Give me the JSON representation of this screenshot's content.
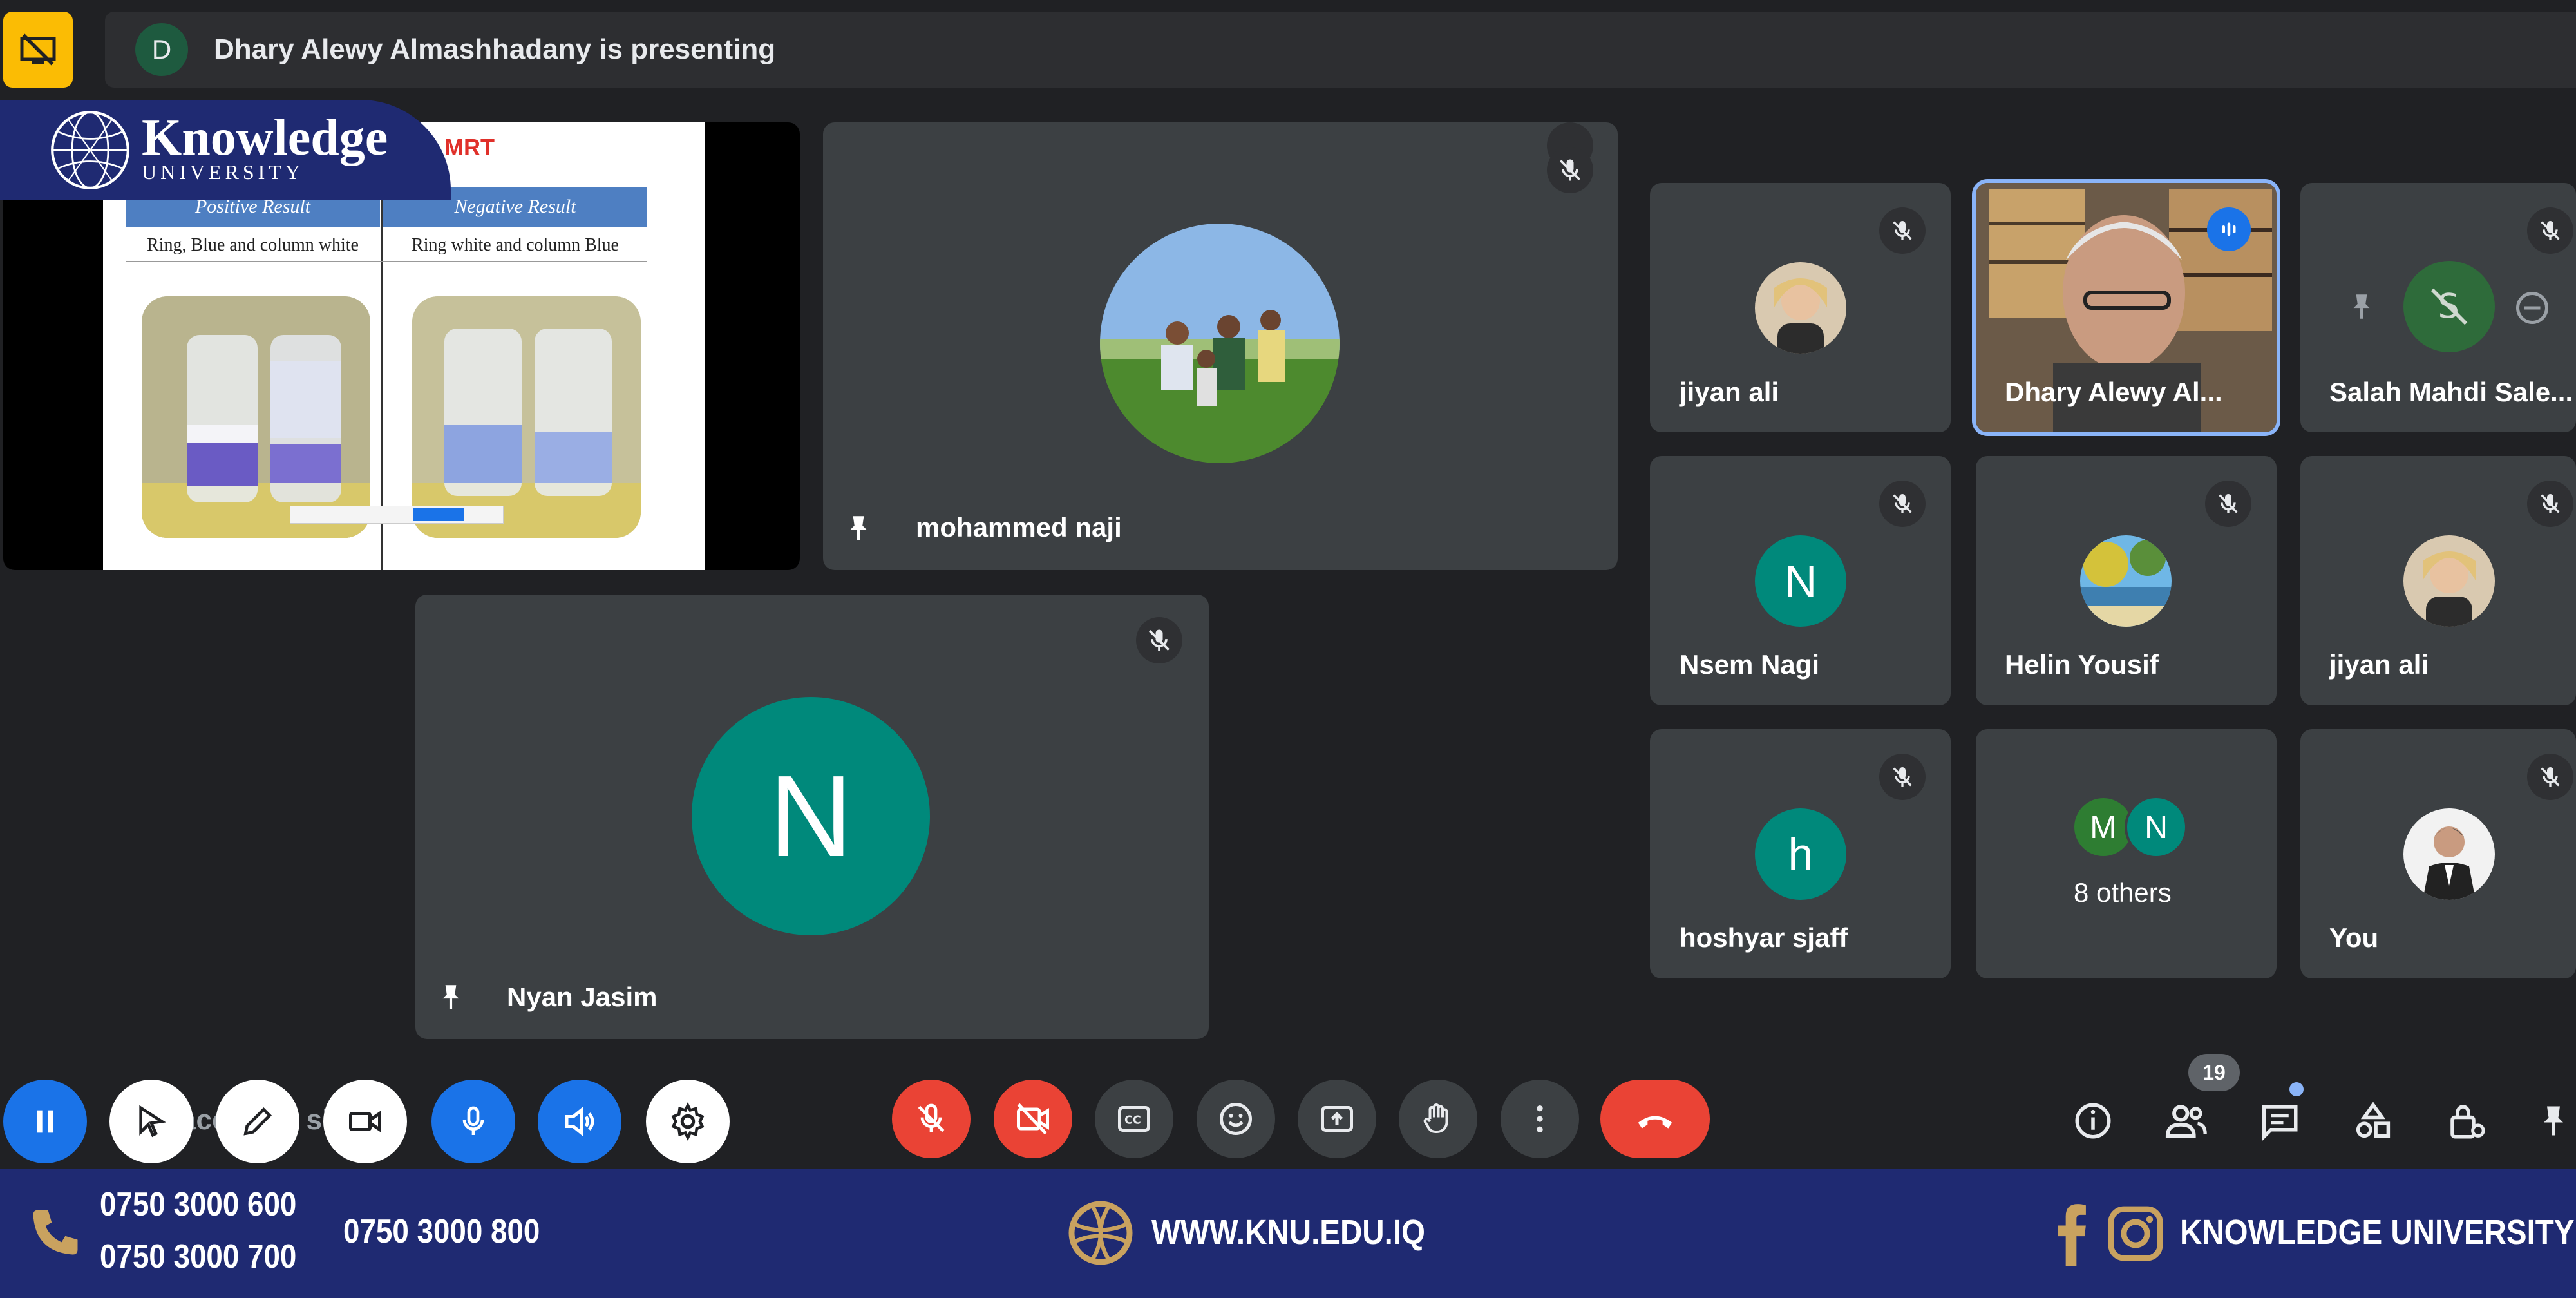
{
  "presenting": {
    "avatar_letter": "D",
    "text": "Dhary Alewy Almashhadany is presenting"
  },
  "logo": {
    "name": "Knowledge",
    "sub": "UNIVERSITY"
  },
  "slide": {
    "title_fragment": "MRT",
    "positive_header": "Positive Result",
    "negative_header": "Negative Result",
    "positive_desc": "Ring, Blue and column white",
    "negative_desc": "Ring white and column Blue"
  },
  "tiles": {
    "mohammed": {
      "name": "mohammed naji"
    },
    "nyan": {
      "name": "Nyan Jasim",
      "letter": "N"
    },
    "jiyan1": {
      "name": "jiyan ali"
    },
    "dhary": {
      "name": "Dhary Alewy Al..."
    },
    "salah": {
      "name": "Salah Mahdi Sale..."
    },
    "nsem": {
      "name": "Nsem Nagi",
      "letter": "N"
    },
    "helin": {
      "name": "Helin Yousif"
    },
    "jiyan2": {
      "name": "jiyan ali"
    },
    "hoshyar": {
      "name": "hoshyar sjaff",
      "letter": "h"
    },
    "others": {
      "name": "8 others",
      "letter1": "M",
      "letter2": "N"
    },
    "you": {
      "name": "You"
    }
  },
  "toolbar": {
    "participant_count": "19",
    "overlay_text": "ace  Bre  si  u  le"
  },
  "footer": {
    "phone1": "0750 3000 600",
    "phone2": "0750 3000 700",
    "phone3": "0750 3000 800",
    "website": "WWW.KNU.EDU.IQ",
    "social": "KNOWLEDGE UNIVERSITY"
  },
  "colors": {
    "background": "#202124",
    "tile": "#3c4043",
    "present_button": "#fbbc04",
    "end_call": "#ea4335",
    "teal_avatar": "#00897b",
    "brand_navy": "#1f2a72",
    "accent_gold": "#c9a25f",
    "active_speaker": "#8ab4f8"
  }
}
